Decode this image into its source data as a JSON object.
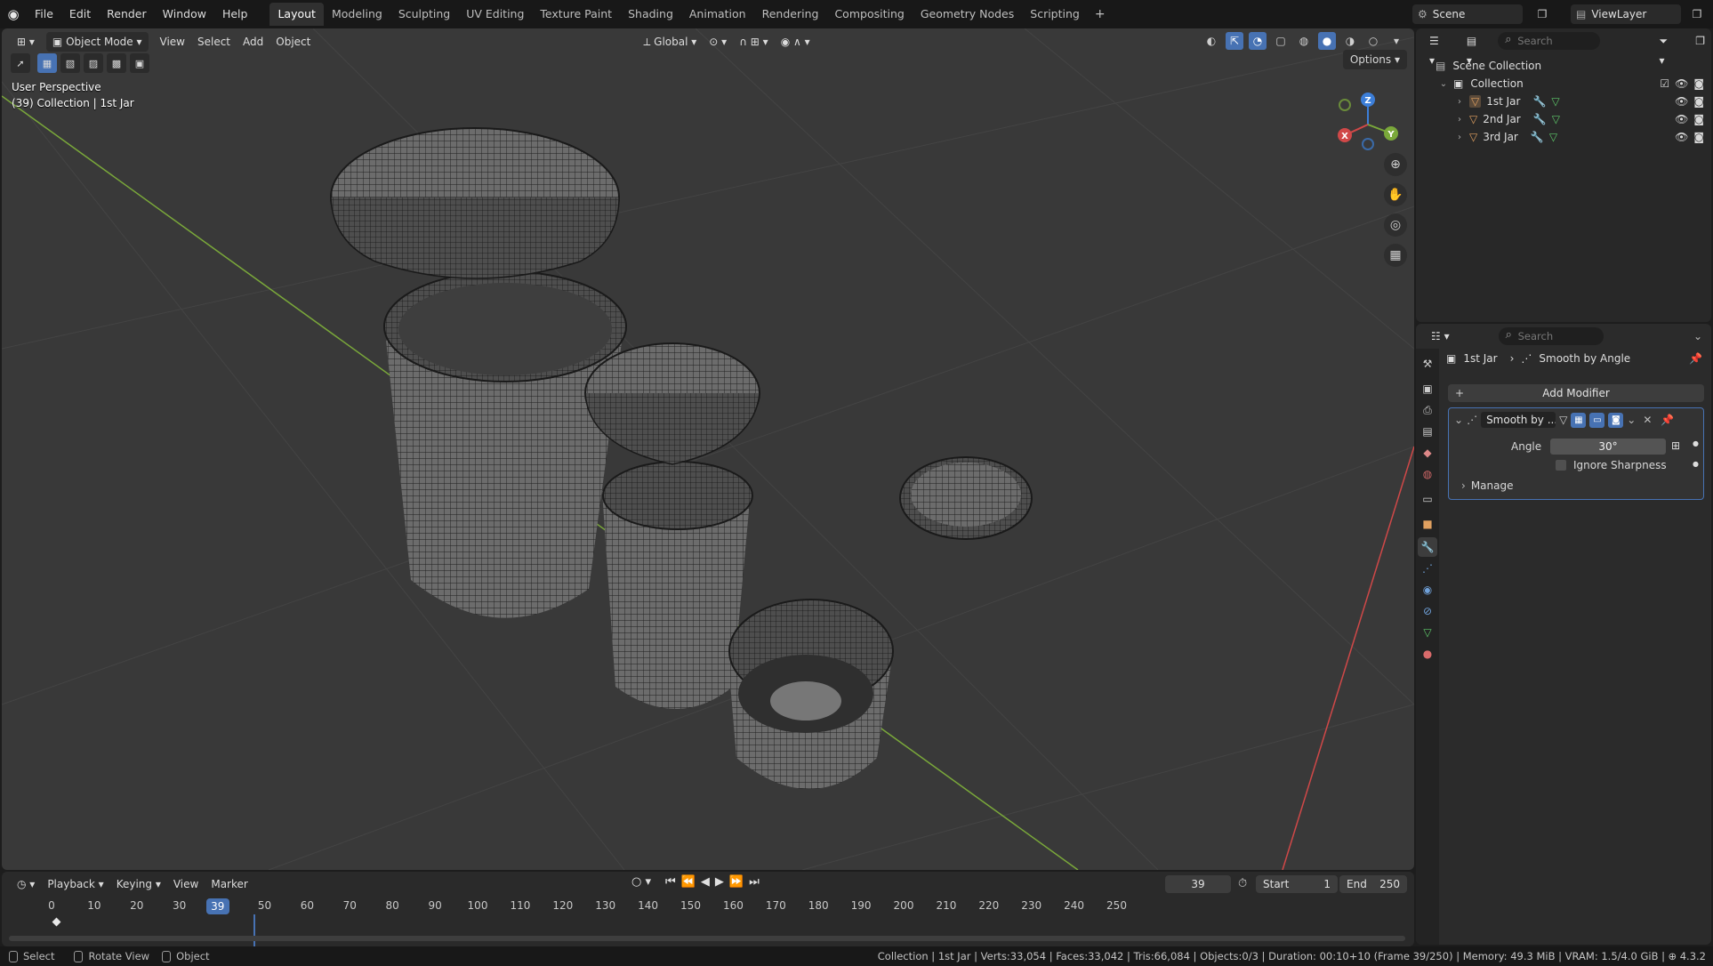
{
  "topbar": {
    "menus": [
      "File",
      "Edit",
      "Render",
      "Window",
      "Help"
    ],
    "workspaces": [
      "Layout",
      "Modeling",
      "Sculpting",
      "UV Editing",
      "Texture Paint",
      "Shading",
      "Animation",
      "Rendering",
      "Compositing",
      "Geometry Nodes",
      "Scripting"
    ],
    "active_workspace": "Layout",
    "add_tab_label": "+",
    "scene": "Scene",
    "view_layer": "ViewLayer"
  },
  "viewport": {
    "mode": "Object Mode",
    "menus": [
      "View",
      "Select",
      "Add",
      "Object"
    ],
    "orientation": "Global",
    "options_label": "Options",
    "info_line1": "User Perspective",
    "info_line2": "(39) Collection | 1st Jar",
    "gizmo": {
      "x": "X",
      "y": "Y",
      "z": "Z"
    }
  },
  "outliner": {
    "search_placeholder": "Search",
    "scene_collection": "Scene Collection",
    "collection": "Collection",
    "objects": [
      "1st Jar",
      "2nd Jar",
      "3rd Jar"
    ]
  },
  "properties": {
    "search_placeholder": "Search",
    "crumb_object": "1st Jar",
    "crumb_modifier": "Smooth by Angle",
    "add_modifier_label": "Add Modifier",
    "modifier": {
      "name": "Smooth by ...",
      "angle_label": "Angle",
      "angle_value": "30°",
      "ignore_sharpness_label": "Ignore Sharpness",
      "ignore_sharpness_checked": false,
      "manage_label": "Manage"
    }
  },
  "timeline": {
    "menus": [
      "Playback",
      "Keying",
      "View",
      "Marker"
    ],
    "current_frame": "39",
    "start_label": "Start",
    "start_value": "1",
    "end_label": "End",
    "end_value": "250",
    "ruler": [
      "0",
      "10",
      "20",
      "30",
      "39",
      "50",
      "60",
      "70",
      "80",
      "90",
      "100",
      "110",
      "120",
      "130",
      "140",
      "150",
      "160",
      "170",
      "180",
      "190",
      "200",
      "210",
      "220",
      "230",
      "240",
      "250"
    ]
  },
  "statusbar": {
    "select": "Select",
    "rotate": "Rotate View",
    "object": "Object",
    "stats": "Collection | 1st Jar | Verts:33,054 | Faces:33,042 | Tris:66,084 | Objects:0/3 | Duration: 00:10+10 (Frame 39/250) | Memory: 49.3 MiB | VRAM: 1.5/4.0 GiB |",
    "version": "4.3.2"
  },
  "colors": {
    "accent": "#4772b3",
    "viewport_bg": "#393939",
    "axis_x": "#d04848",
    "axis_y": "#7aa83a",
    "object_icon": "#e0a060",
    "mesh_icon": "#5ec86a"
  }
}
